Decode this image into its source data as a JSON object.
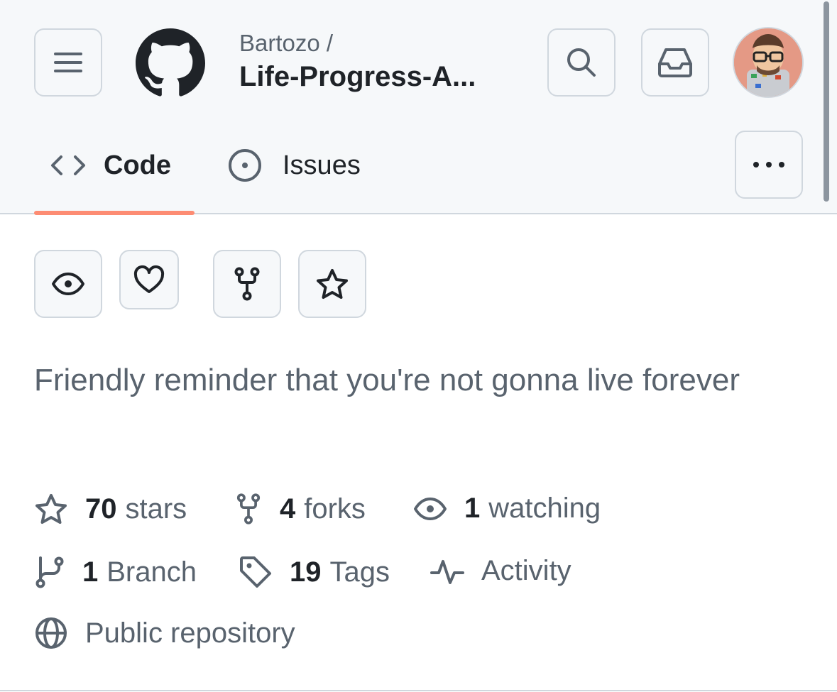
{
  "header": {
    "owner": "Bartozo /",
    "repo": "Life-Progress-A...",
    "menu_icon": "hamburger-icon",
    "logo_icon": "github-logo",
    "search_icon": "search-icon",
    "inbox_icon": "inbox-icon",
    "avatar": "memoji-avatar"
  },
  "tabs": [
    {
      "label": "Code",
      "icon": "code-icon",
      "selected": true
    },
    {
      "label": "Issues",
      "icon": "issue-opened-icon",
      "selected": false
    }
  ],
  "more_icon": "kebab-horizontal-icon",
  "actions": [
    {
      "icon": "eye-icon"
    },
    {
      "icon": "heart-icon"
    },
    {
      "icon": "repo-forked-icon"
    },
    {
      "icon": "star-icon"
    }
  ],
  "description": "Friendly reminder that you're not gonna live forever",
  "stats": {
    "stars": {
      "count": "70",
      "label": "stars"
    },
    "forks": {
      "count": "4",
      "label": "forks"
    },
    "watching": {
      "count": "1",
      "label": "watching"
    },
    "branches": {
      "count": "1",
      "label": "Branch"
    },
    "tags": {
      "count": "19",
      "label": "Tags"
    },
    "activity": {
      "label": "Activity"
    },
    "visibility": {
      "label": "Public repository"
    }
  },
  "colors": {
    "accent_underline": "#fd8c73",
    "header_bg": "#f6f8fa",
    "muted_text": "#59636e",
    "border": "#d0d7de"
  }
}
